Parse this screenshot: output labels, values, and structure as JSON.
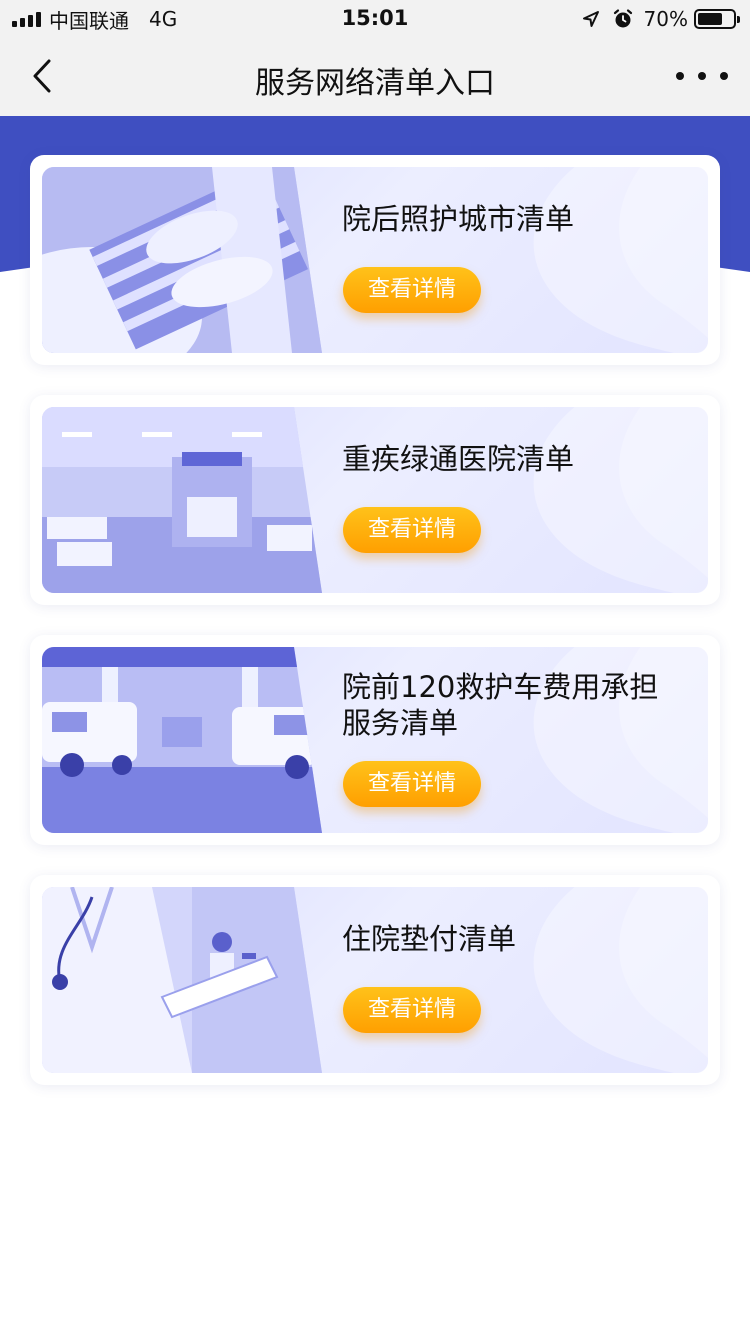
{
  "status_bar": {
    "carrier": "中国联通",
    "network": "4G",
    "time": "15:01",
    "battery_percent": "70%",
    "battery_level": 0.7
  },
  "nav": {
    "title": "服务网络清单入口",
    "back_icon": "chevron-left-icon",
    "more_icon": "more-horizontal-icon"
  },
  "colors": {
    "banner": "#3f4fc1",
    "card_bg": "#e2e4ff",
    "button_top": "#ffc21a",
    "button_bottom": "#ff9f00"
  },
  "cards": [
    {
      "title": "院后照护城市清单",
      "button_label": "查看详情",
      "image": "patient-hands-photo"
    },
    {
      "title": "重疾绿通医院清单",
      "button_label": "查看详情",
      "image": "hospital-ward-photo"
    },
    {
      "title": "院前120救护车费用承担服务清单",
      "button_label": "查看详情",
      "image": "ambulance-garage-photo"
    },
    {
      "title": "住院垫付清单",
      "button_label": "查看详情",
      "image": "doctor-clipboard-photo"
    }
  ]
}
